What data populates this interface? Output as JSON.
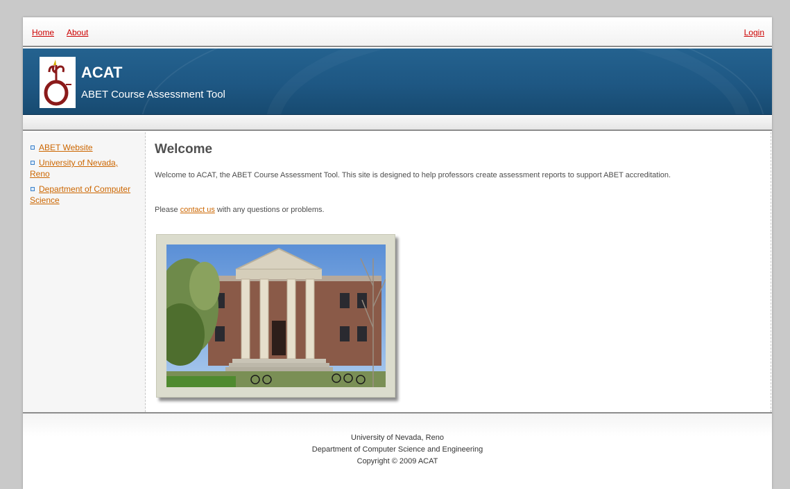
{
  "nav": {
    "home": "Home",
    "about": "About",
    "login": "Login"
  },
  "header": {
    "title": "ACAT",
    "subtitle": "ABET Course Assessment Tool"
  },
  "sidebar": {
    "items": [
      {
        "label": "ABET Website"
      },
      {
        "label": "University of Nevada, Reno"
      },
      {
        "label": "Department of Computer Science"
      }
    ]
  },
  "main": {
    "title": "Welcome",
    "intro": "Welcome to ACAT, the ABET Course Assessment Tool. This site is designed to help professors create assessment reports to support ABET accreditation.",
    "contact_prefix": "Please ",
    "contact_link": "contact us",
    "contact_suffix": " with any questions or problems."
  },
  "footer": {
    "line1": "University of Nevada, Reno",
    "line2": "Department of Computer Science and Engineering",
    "line3": "Copyright © 2009 ACAT"
  },
  "colors": {
    "link": "#cc6600",
    "nav_link": "#cc0000",
    "header_blue": "#1e5783"
  }
}
